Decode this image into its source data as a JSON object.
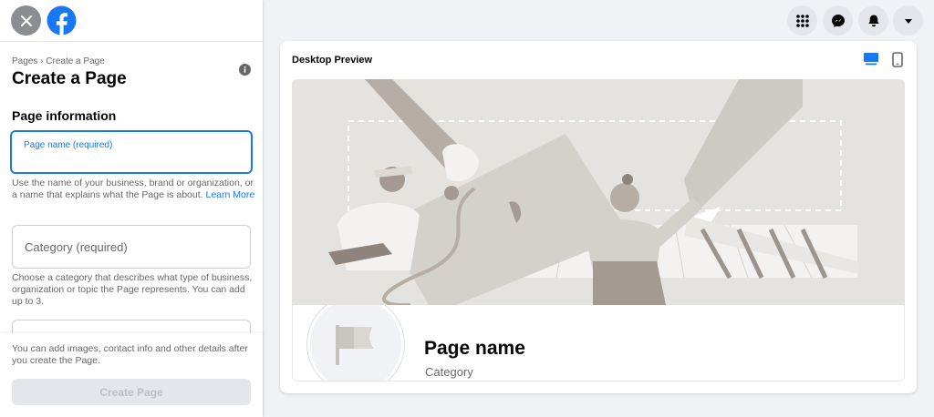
{
  "breadcrumb": {
    "item1": "Pages",
    "separator": "›",
    "item2": "Create a Page"
  },
  "page_title": "Create a Page",
  "section_title": "Page information",
  "fields": {
    "name_label": "Page name (required)",
    "name_value": "",
    "name_helper_text": "Use the name of your business, brand or organization, or a name that explains what the Page is about.",
    "name_helper_link": "Learn More",
    "category_label": "Category (required)",
    "category_helper": "Choose a category that describes what type of business, organization or topic the Page represents. You can add up to 3."
  },
  "bottom": {
    "note": "You can add images, contact info and other details after you create the Page.",
    "create_label": "Create Page"
  },
  "preview": {
    "title": "Desktop Preview",
    "page_name": "Page name",
    "category": "Category"
  },
  "nav_icons": [
    "close-icon",
    "facebook-logo",
    "menu-grid-icon",
    "messenger-icon",
    "notifications-bell-icon",
    "account-dropdown-icon",
    "info-icon",
    "desktop-icon",
    "mobile-icon",
    "flag-icon"
  ],
  "colors": {
    "brand": "#1877f2",
    "muted": "#65676b",
    "disabled": "#e4e6eb",
    "background": "#f0f2f5"
  }
}
